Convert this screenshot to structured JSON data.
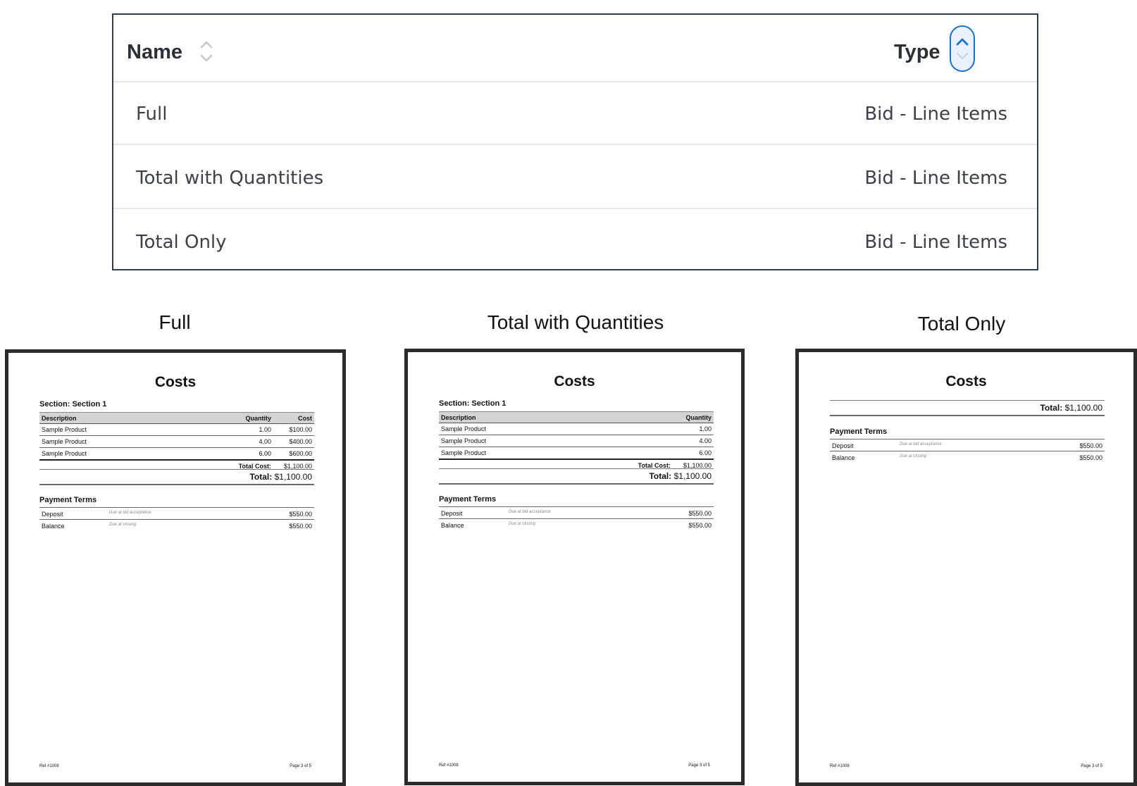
{
  "table": {
    "headers": {
      "name": "Name",
      "type": "Type"
    },
    "rows": [
      {
        "name": "Full",
        "type": "Bid - Line Items"
      },
      {
        "name": "Total with Quantities",
        "type": "Bid - Line Items"
      },
      {
        "name": "Total Only",
        "type": "Bid - Line Items"
      }
    ],
    "sort": {
      "column": "Type",
      "direction": "ascending"
    },
    "accent_color": "#1a6fd1"
  },
  "previews": {
    "full": {
      "caption": "Full"
    },
    "total_with_quantities": {
      "caption": "Total with Quantities"
    },
    "total_only": {
      "caption": "Total Only"
    }
  },
  "document": {
    "title": "Costs",
    "section_label": "Section: Section 1",
    "columns": {
      "description": "Description",
      "quantity": "Quantity",
      "cost": "Cost"
    },
    "items": [
      {
        "description": "Sample Product",
        "quantity": "1.00",
        "cost": "$100.00"
      },
      {
        "description": "Sample Product",
        "quantity": "4.00",
        "cost": "$400.00"
      },
      {
        "description": "Sample Product",
        "quantity": "6.00",
        "cost": "$600.00"
      }
    ],
    "total_cost_label": "Total Cost:",
    "total_cost_value": "$1,100.00",
    "total_label": "Total:",
    "total_value": "$1,100.00",
    "payment_terms_title": "Payment Terms",
    "payments": [
      {
        "name": "Deposit",
        "desc": "Due at bid acceptance",
        "amount": "$550.00"
      },
      {
        "name": "Balance",
        "desc": "Due at closing",
        "amount": "$550.00"
      }
    ],
    "ref": "Ref #1008",
    "page": "Page 3 of 5"
  }
}
